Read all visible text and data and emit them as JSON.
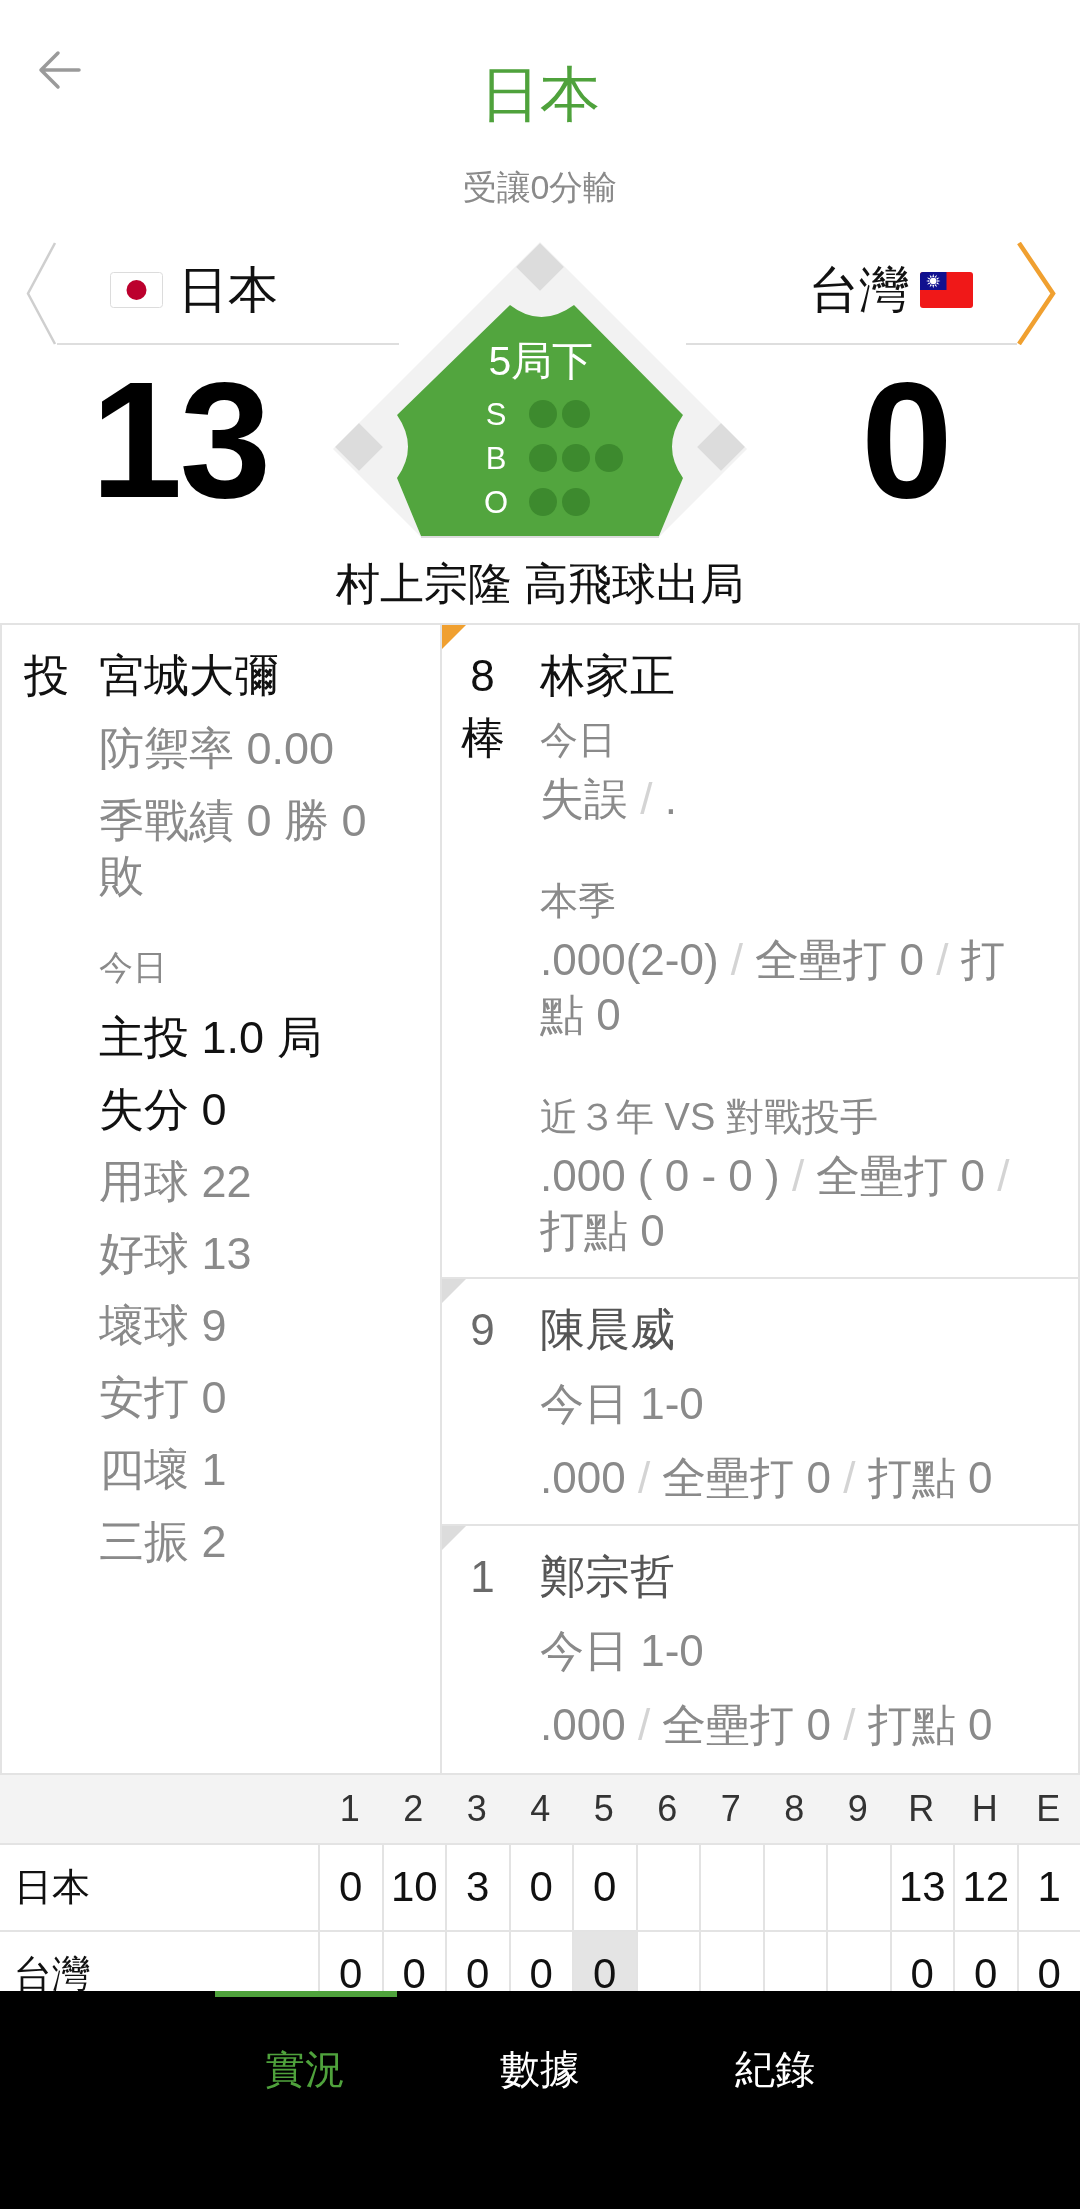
{
  "header": {
    "title": "日本",
    "subtitle": "受讓0分輸"
  },
  "teams": [
    {
      "name": "日本",
      "kind": "japan",
      "score": "13",
      "batting": false
    },
    {
      "name": "台灣",
      "kind": "taiwan",
      "score": "0",
      "batting": true
    }
  ],
  "diamond": {
    "inning": "5局下",
    "count": [
      {
        "letter": "S",
        "lights": [
          false,
          false
        ]
      },
      {
        "letter": "B",
        "lights": [
          false,
          false,
          false
        ]
      },
      {
        "letter": "O",
        "lights": [
          false,
          false
        ]
      }
    ],
    "bases": [
      {
        "occupied": false
      },
      {
        "occupied": false
      },
      {
        "occupied": false
      }
    ]
  },
  "last_play": "村上宗隆 高飛球出局",
  "pitcher": {
    "role": "投",
    "name": "宮城大彌",
    "stats": [
      "防禦率 0.00",
      "季戰績 0 勝 0 敗"
    ],
    "today": {
      "label": "今日",
      "items": [
        {
          "text": "主投 1.0 局",
          "emphasized": true
        },
        {
          "text": "失分 0",
          "emphasized": true
        },
        {
          "text": "用球 22",
          "emphasized": false
        },
        {
          "text": "好球 13",
          "emphasized": false
        },
        {
          "text": "壞球 9",
          "emphasized": false
        },
        {
          "text": "安打 0",
          "emphasized": false
        },
        {
          "text": "四壞 1",
          "emphasized": false
        },
        {
          "text": "三振 2",
          "emphasized": false
        }
      ]
    }
  },
  "batters": [
    {
      "order": "8",
      "order_suffix": "棒",
      "name": "林家正",
      "current": true,
      "sections": [
        {
          "kind": "labeled",
          "label": "今日",
          "segments": [
            {
              "text": "失誤",
              "faint": false
            },
            {
              "text": "/",
              "faint": true
            },
            {
              "text": ".",
              "faint": false
            }
          ]
        },
        {
          "kind": "labeled",
          "label": "本季",
          "segments": [
            {
              "text": ".000(2-0)",
              "faint": false
            },
            {
              "text": "/",
              "faint": true
            },
            {
              "text": "全壘打 0",
              "faint": false
            },
            {
              "text": "/",
              "faint": true
            },
            {
              "text": "打點 0",
              "faint": false
            }
          ]
        },
        {
          "kind": "labeled",
          "label": "近３年 VS 對戰投手",
          "segments": [
            {
              "text": ".000 ( 0 - 0 )",
              "faint": false
            },
            {
              "text": "/",
              "faint": true
            },
            {
              "text": "全壘打 0",
              "faint": false
            },
            {
              "text": "/",
              "faint": true
            },
            {
              "text": "打點 0",
              "faint": false
            }
          ]
        }
      ]
    },
    {
      "order": "9",
      "name": "陳晨威",
      "current": false,
      "sections": [
        {
          "kind": "plain",
          "segments": [
            {
              "text": "今日 1-0",
              "faint": false
            }
          ]
        },
        {
          "kind": "plain",
          "segments": [
            {
              "text": ".000",
              "faint": false
            },
            {
              "text": "/",
              "faint": true
            },
            {
              "text": "全壘打 0",
              "faint": false
            },
            {
              "text": "/",
              "faint": true
            },
            {
              "text": "打點 0",
              "faint": false
            }
          ]
        }
      ]
    },
    {
      "order": "1",
      "name": "鄭宗哲",
      "current": false,
      "sections": [
        {
          "kind": "plain",
          "segments": [
            {
              "text": "今日 1-0",
              "faint": false
            }
          ]
        },
        {
          "kind": "plain",
          "segments": [
            {
              "text": ".000",
              "faint": false
            },
            {
              "text": "/",
              "faint": true
            },
            {
              "text": "全壘打 0",
              "faint": false
            },
            {
              "text": "/",
              "faint": true
            },
            {
              "text": "打點 0",
              "faint": false
            }
          ]
        }
      ]
    }
  ],
  "linescore": {
    "columns": [
      "1",
      "2",
      "3",
      "4",
      "5",
      "6",
      "7",
      "8",
      "9",
      "R",
      "H",
      "E"
    ],
    "rows": [
      {
        "team": "日本",
        "innings": [
          {
            "runs": "0",
            "current": false
          },
          {
            "runs": "10",
            "current": false
          },
          {
            "runs": "3",
            "current": false
          },
          {
            "runs": "0",
            "current": false
          },
          {
            "runs": "0",
            "current": false
          }
        ],
        "totals": [
          "13",
          "12",
          "1"
        ]
      },
      {
        "team": "台灣",
        "innings": [
          {
            "runs": "0",
            "current": false
          },
          {
            "runs": "0",
            "current": false
          },
          {
            "runs": "0",
            "current": false
          },
          {
            "runs": "0",
            "current": false
          },
          {
            "runs": "0",
            "current": true
          }
        ],
        "totals": [
          "0",
          "0",
          "0"
        ]
      }
    ]
  },
  "tabs": [
    {
      "label": "實況",
      "selected": true
    },
    {
      "label": "數據",
      "selected": false
    },
    {
      "label": "紀錄",
      "selected": false
    }
  ]
}
